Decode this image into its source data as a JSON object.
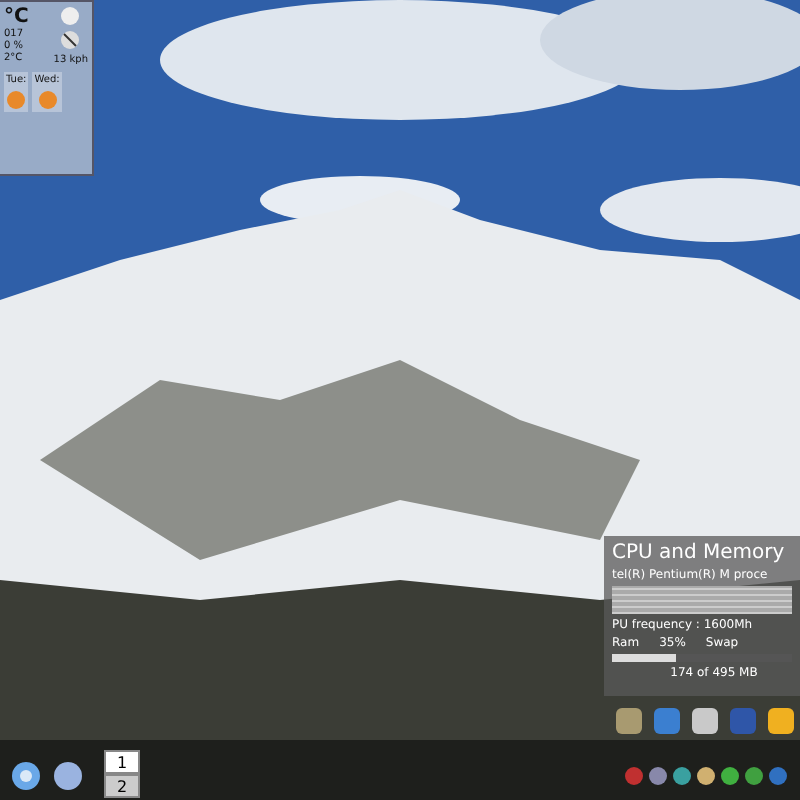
{
  "weather_widget": {
    "temperature": "°C",
    "line_1": "017",
    "line_2": "0 %",
    "line_3": "2°C",
    "wind": "13 kph",
    "forecast": [
      {
        "day": "Tue:"
      },
      {
        "day": "Wed:"
      }
    ]
  },
  "system_monitor": {
    "title": "CPU and Memory",
    "cpu_name": "tel(R) Pentium(R) M proce",
    "frequency": "PU frequency : 1600Mh",
    "ram_label": "Ram",
    "ram_percent": "35%",
    "swap_label": "Swap",
    "memory_usage": "174 of 495 MB",
    "level": 0.35
  },
  "pager": [
    {
      "label": "1",
      "selected": true
    },
    {
      "label": "2",
      "selected": false
    }
  ]
}
